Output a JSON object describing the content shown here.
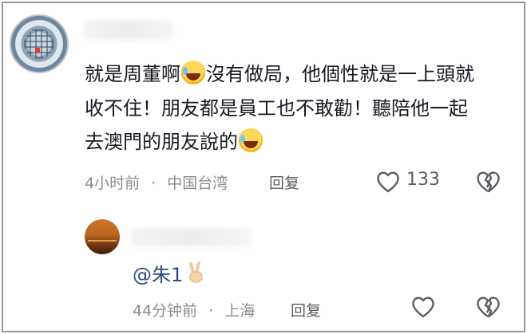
{
  "comment": {
    "lines": [
      [
        "就是周董啊",
        "😅",
        "沒有做局，他個性就是一上頭就"
      ],
      [
        "收不住！朋友都是員工也不敢勸！聽陪他一起"
      ],
      [
        "去澳門的朋友說的",
        "😂"
      ]
    ],
    "time": "4小时前",
    "separator": "·",
    "location": "中国台湾",
    "reply_label": "回复",
    "like_count": "133"
  },
  "reply": {
    "mention": "@朱1",
    "emoji": "✌️",
    "time": "44分钟前",
    "separator": "·",
    "location": "上海",
    "reply_label": "回复"
  },
  "colors": {
    "text": "#161823",
    "meta": "#8a8b91",
    "mention": "#2c4a7d",
    "icon": "#5c5d63"
  },
  "icons": {
    "like": "heart-outline-icon",
    "dislike": "broken-heart-icon"
  }
}
